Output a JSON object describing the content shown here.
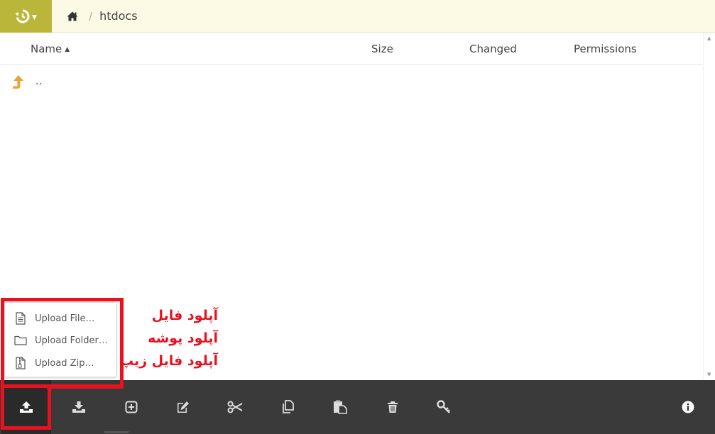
{
  "breadcrumb": {
    "current": "htdocs",
    "separator": "/"
  },
  "table": {
    "columns": {
      "name": "Name",
      "size": "Size",
      "changed": "Changed",
      "permissions": "Permissions"
    },
    "sort": {
      "column": "name",
      "direction": "ascending"
    },
    "rows": [
      {
        "name": "..",
        "type": "parent-directory"
      }
    ]
  },
  "upload_menu": {
    "items": [
      {
        "label": "Upload File…",
        "icon": "file-text-icon"
      },
      {
        "label": "Upload Folder…",
        "icon": "folder-icon"
      },
      {
        "label": "Upload Zip…",
        "icon": "zip-file-icon"
      }
    ]
  },
  "annotations": [
    "آپلود فایل",
    "آپلود پوشه",
    "آپلود فایل زیپ"
  ],
  "toolbar": {
    "buttons": [
      {
        "name": "upload",
        "icon": "upload-icon",
        "active": true
      },
      {
        "name": "download",
        "icon": "download-icon"
      },
      {
        "name": "new",
        "icon": "plus-square-icon"
      },
      {
        "name": "rename",
        "icon": "edit-icon"
      },
      {
        "name": "cut",
        "icon": "scissors-icon"
      },
      {
        "name": "copy",
        "icon": "copy-icon"
      },
      {
        "name": "paste",
        "icon": "paste-icon"
      },
      {
        "name": "delete",
        "icon": "trash-icon"
      },
      {
        "name": "permissions",
        "icon": "key-icon"
      },
      {
        "name": "info",
        "icon": "info-icon"
      }
    ]
  },
  "colors": {
    "brand": "#b9b63a",
    "topbar_bg": "#fcfae4",
    "toolbar_bg": "#3a3a3a",
    "parent_arrow": "#e8a33a",
    "annotation_red": "#e8121f"
  }
}
